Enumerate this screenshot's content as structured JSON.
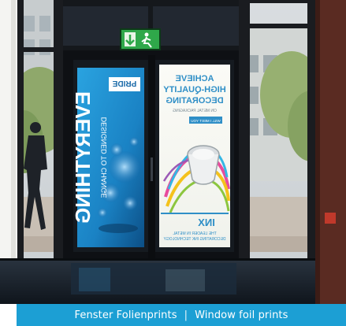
{
  "caption": {
    "german": "Fenster Folienprints",
    "separator": "|",
    "english": "Window foil prints"
  },
  "poster_left": {
    "headline": "EVERYTHING",
    "tagline": "DESIGNED TO CHANGE",
    "brand": "PRIDE"
  },
  "poster_right": {
    "line1": "ACHIEVE",
    "line2": "HIGH-QUALITY",
    "line3": "DECORATING",
    "line4": "ON METAL PACKAGING",
    "badge": "WILL I MEET YOU",
    "brand": "INX",
    "tagline_a": "THE LEADER IN METAL",
    "tagline_b": "DECORATING INK TECHNOLOGY"
  },
  "colors": {
    "caption_bar": "#1c9fd4",
    "poster_left": "#1f8fd0",
    "poster_right_accent": "#2f8fc7",
    "exit_sign": "#2fa84a"
  }
}
